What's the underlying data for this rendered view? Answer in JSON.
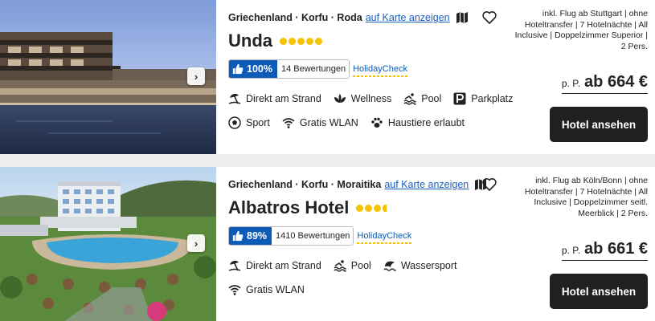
{
  "hotels": [
    {
      "location": "Griechenland · Korfu · Roda",
      "map_link": "auf Karte anzeigen",
      "name": "Unda",
      "stars": 5,
      "rating_percent": "100%",
      "review_count": "14 Bewertungen",
      "rating_brand": "HolidayCheck",
      "amenities_row1": [
        {
          "icon": "beach-umbrella-icon",
          "label": "Direkt am Strand"
        },
        {
          "icon": "lotus-icon",
          "label": "Wellness"
        },
        {
          "icon": "pool-icon",
          "label": "Pool"
        },
        {
          "icon": "parking-icon",
          "label": "Parkplatz"
        }
      ],
      "amenities_row2": [
        {
          "icon": "soccer-ball-icon",
          "label": "Sport"
        },
        {
          "icon": "wifi-icon",
          "label": "Gratis WLAN"
        },
        {
          "icon": "paw-icon",
          "label": "Haustiere erlaubt"
        }
      ],
      "offer_text": "inkl. Flug ab Stuttgart | ohne Hoteltransfer | 7 Hotelnächte | All Inclusive | Doppelzimmer Superior | 2 Pers.",
      "price_prefix": "p. P.",
      "price": "ab 664 €",
      "cta": "Hotel ansehen"
    },
    {
      "location": "Griechenland · Korfu · Moraitika",
      "map_link": "auf Karte anzeigen",
      "name": "Albatros Hotel",
      "stars": 3.5,
      "rating_percent": "89%",
      "review_count": "1410 Bewertungen",
      "rating_brand": "HolidayCheck",
      "amenities_row1": [
        {
          "icon": "beach-umbrella-icon",
          "label": "Direkt am Strand"
        },
        {
          "icon": "pool-icon",
          "label": "Pool"
        },
        {
          "icon": "water-sports-icon",
          "label": "Wassersport"
        }
      ],
      "amenities_row2": [
        {
          "icon": "wifi-icon",
          "label": "Gratis WLAN"
        }
      ],
      "offer_text": "inkl. Flug ab Köln/Bonn | ohne Hoteltransfer | 7 Hotelnächte | All Inclusive | Doppelzimmer seitl. Meerblick | 2 Pers.",
      "price_prefix": "p. P.",
      "price": "ab 661 €",
      "cta": "Hotel ansehen"
    }
  ],
  "colors": {
    "rating_blue": "#0c5bb6",
    "star_yellow": "#f5c300",
    "cta_bg": "#22201e",
    "link_blue": "#1a5dbf"
  }
}
